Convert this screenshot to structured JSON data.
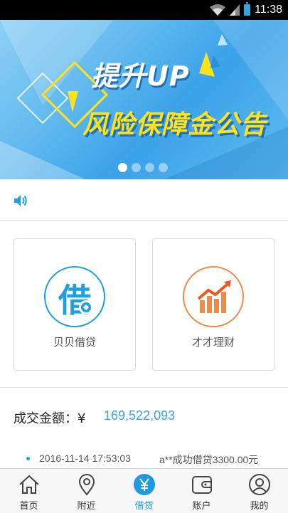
{
  "status_bar": {
    "time": "11:38"
  },
  "banner": {
    "headline_line1": "提升UP",
    "headline_line2": "风险保障金公告",
    "slide_count": 4,
    "active_slide": 1
  },
  "notice": {
    "icon": "speaker-icon"
  },
  "products": [
    {
      "label": "贝贝借贷",
      "icon_char": "借",
      "icon": "borrow-icon",
      "color": "#1ea0e0"
    },
    {
      "label": "才才理财",
      "icon": "chart-up-icon",
      "color": "#f08a4b"
    }
  ],
  "volume": {
    "label": "成交金额：¥",
    "value": "169,522,093"
  },
  "ticker": {
    "timestamp": "2016-11-14 17:53:03",
    "message": "a**成功借贷3300.00元"
  },
  "tabs": [
    {
      "label": "首页",
      "icon": "home-icon"
    },
    {
      "label": "附近",
      "icon": "location-pin-icon"
    },
    {
      "label": "借贷",
      "icon": "yuan-icon",
      "active": true
    },
    {
      "label": "账户",
      "icon": "wallet-icon"
    },
    {
      "label": "我的",
      "icon": "user-icon"
    }
  ],
  "colors": {
    "accent": "#1ea0e0",
    "invest": "#f08a4b",
    "banner_text": "#ffe21a"
  }
}
